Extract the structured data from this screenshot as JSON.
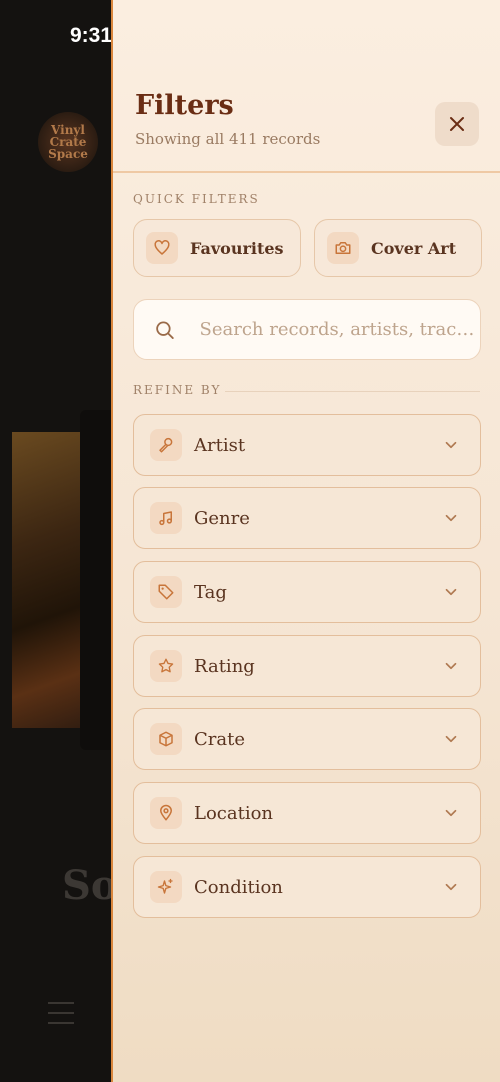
{
  "status_bar": {
    "time": "9:31"
  },
  "background": {
    "logo_text": "Vinyl Crate Space",
    "title_fragment": "So"
  },
  "drawer": {
    "title": "Filters",
    "subtitle": "Showing all 411 records",
    "close_icon": "close-icon",
    "quick_filters_label": "QUICK FILTERS",
    "quick_filters": [
      {
        "label": "Favourites",
        "icon": "heart-icon"
      },
      {
        "label": "Cover Art",
        "icon": "camera-icon"
      }
    ],
    "search": {
      "placeholder": "Search records, artists, tracks...",
      "value": ""
    },
    "refine_label": "REFINE BY",
    "filters": [
      {
        "label": "Artist",
        "icon": "microphone-icon"
      },
      {
        "label": "Genre",
        "icon": "music-note-icon"
      },
      {
        "label": "Tag",
        "icon": "tag-icon"
      },
      {
        "label": "Rating",
        "icon": "star-icon"
      },
      {
        "label": "Crate",
        "icon": "box-icon"
      },
      {
        "label": "Location",
        "icon": "map-pin-icon"
      },
      {
        "label": "Condition",
        "icon": "sparkles-icon"
      }
    ]
  },
  "colors": {
    "accent": "#d9863d",
    "title": "#6a2d14",
    "icon": "#c8753a",
    "drawer_bg": "#fbeee0"
  }
}
